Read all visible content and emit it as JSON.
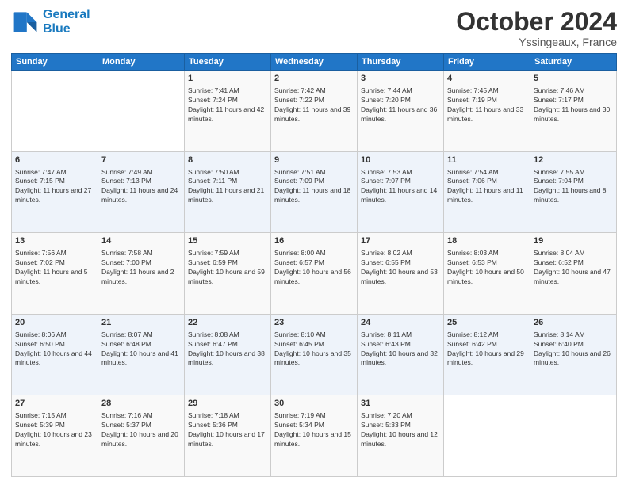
{
  "logo": {
    "line1": "General",
    "line2": "Blue"
  },
  "header": {
    "month": "October 2024",
    "location": "Yssingeaux, France"
  },
  "weekdays": [
    "Sunday",
    "Monday",
    "Tuesday",
    "Wednesday",
    "Thursday",
    "Friday",
    "Saturday"
  ],
  "weeks": [
    [
      {
        "day": "",
        "content": ""
      },
      {
        "day": "",
        "content": ""
      },
      {
        "day": "1",
        "content": "Sunrise: 7:41 AM\nSunset: 7:24 PM\nDaylight: 11 hours and 42 minutes."
      },
      {
        "day": "2",
        "content": "Sunrise: 7:42 AM\nSunset: 7:22 PM\nDaylight: 11 hours and 39 minutes."
      },
      {
        "day": "3",
        "content": "Sunrise: 7:44 AM\nSunset: 7:20 PM\nDaylight: 11 hours and 36 minutes."
      },
      {
        "day": "4",
        "content": "Sunrise: 7:45 AM\nSunset: 7:19 PM\nDaylight: 11 hours and 33 minutes."
      },
      {
        "day": "5",
        "content": "Sunrise: 7:46 AM\nSunset: 7:17 PM\nDaylight: 11 hours and 30 minutes."
      }
    ],
    [
      {
        "day": "6",
        "content": "Sunrise: 7:47 AM\nSunset: 7:15 PM\nDaylight: 11 hours and 27 minutes."
      },
      {
        "day": "7",
        "content": "Sunrise: 7:49 AM\nSunset: 7:13 PM\nDaylight: 11 hours and 24 minutes."
      },
      {
        "day": "8",
        "content": "Sunrise: 7:50 AM\nSunset: 7:11 PM\nDaylight: 11 hours and 21 minutes."
      },
      {
        "day": "9",
        "content": "Sunrise: 7:51 AM\nSunset: 7:09 PM\nDaylight: 11 hours and 18 minutes."
      },
      {
        "day": "10",
        "content": "Sunrise: 7:53 AM\nSunset: 7:07 PM\nDaylight: 11 hours and 14 minutes."
      },
      {
        "day": "11",
        "content": "Sunrise: 7:54 AM\nSunset: 7:06 PM\nDaylight: 11 hours and 11 minutes."
      },
      {
        "day": "12",
        "content": "Sunrise: 7:55 AM\nSunset: 7:04 PM\nDaylight: 11 hours and 8 minutes."
      }
    ],
    [
      {
        "day": "13",
        "content": "Sunrise: 7:56 AM\nSunset: 7:02 PM\nDaylight: 11 hours and 5 minutes."
      },
      {
        "day": "14",
        "content": "Sunrise: 7:58 AM\nSunset: 7:00 PM\nDaylight: 11 hours and 2 minutes."
      },
      {
        "day": "15",
        "content": "Sunrise: 7:59 AM\nSunset: 6:59 PM\nDaylight: 10 hours and 59 minutes."
      },
      {
        "day": "16",
        "content": "Sunrise: 8:00 AM\nSunset: 6:57 PM\nDaylight: 10 hours and 56 minutes."
      },
      {
        "day": "17",
        "content": "Sunrise: 8:02 AM\nSunset: 6:55 PM\nDaylight: 10 hours and 53 minutes."
      },
      {
        "day": "18",
        "content": "Sunrise: 8:03 AM\nSunset: 6:53 PM\nDaylight: 10 hours and 50 minutes."
      },
      {
        "day": "19",
        "content": "Sunrise: 8:04 AM\nSunset: 6:52 PM\nDaylight: 10 hours and 47 minutes."
      }
    ],
    [
      {
        "day": "20",
        "content": "Sunrise: 8:06 AM\nSunset: 6:50 PM\nDaylight: 10 hours and 44 minutes."
      },
      {
        "day": "21",
        "content": "Sunrise: 8:07 AM\nSunset: 6:48 PM\nDaylight: 10 hours and 41 minutes."
      },
      {
        "day": "22",
        "content": "Sunrise: 8:08 AM\nSunset: 6:47 PM\nDaylight: 10 hours and 38 minutes."
      },
      {
        "day": "23",
        "content": "Sunrise: 8:10 AM\nSunset: 6:45 PM\nDaylight: 10 hours and 35 minutes."
      },
      {
        "day": "24",
        "content": "Sunrise: 8:11 AM\nSunset: 6:43 PM\nDaylight: 10 hours and 32 minutes."
      },
      {
        "day": "25",
        "content": "Sunrise: 8:12 AM\nSunset: 6:42 PM\nDaylight: 10 hours and 29 minutes."
      },
      {
        "day": "26",
        "content": "Sunrise: 8:14 AM\nSunset: 6:40 PM\nDaylight: 10 hours and 26 minutes."
      }
    ],
    [
      {
        "day": "27",
        "content": "Sunrise: 7:15 AM\nSunset: 5:39 PM\nDaylight: 10 hours and 23 minutes."
      },
      {
        "day": "28",
        "content": "Sunrise: 7:16 AM\nSunset: 5:37 PM\nDaylight: 10 hours and 20 minutes."
      },
      {
        "day": "29",
        "content": "Sunrise: 7:18 AM\nSunset: 5:36 PM\nDaylight: 10 hours and 17 minutes."
      },
      {
        "day": "30",
        "content": "Sunrise: 7:19 AM\nSunset: 5:34 PM\nDaylight: 10 hours and 15 minutes."
      },
      {
        "day": "31",
        "content": "Sunrise: 7:20 AM\nSunset: 5:33 PM\nDaylight: 10 hours and 12 minutes."
      },
      {
        "day": "",
        "content": ""
      },
      {
        "day": "",
        "content": ""
      }
    ]
  ]
}
